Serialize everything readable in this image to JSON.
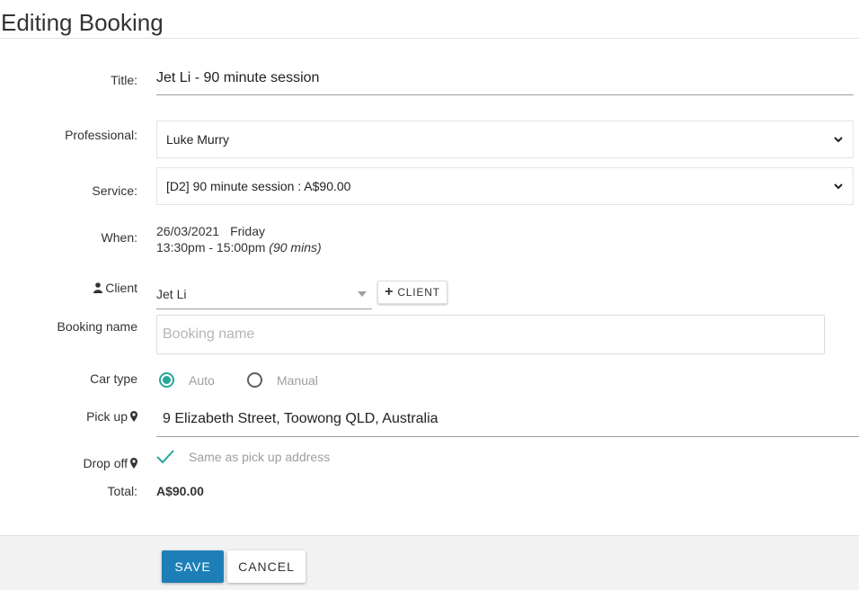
{
  "page": {
    "title": "Editing Booking"
  },
  "form": {
    "title": {
      "label": "Title:",
      "value": "Jet Li - 90 minute session"
    },
    "professional": {
      "label": "Professional:",
      "value": "Luke Murry"
    },
    "service": {
      "label": "Service:",
      "value": "[D2] 90 minute session : A$90.00"
    },
    "when": {
      "label": "When:",
      "date": "26/03/2021",
      "day": "Friday",
      "time": "13:30pm - 15:00pm",
      "duration": "(90 mins)"
    },
    "client": {
      "label": "Client",
      "value": "Jet Li",
      "add_button": "CLIENT"
    },
    "booking_name": {
      "label": "Booking name",
      "value": "",
      "placeholder": "Booking name"
    },
    "car_type": {
      "label": "Car type",
      "options": [
        "Auto",
        "Manual"
      ],
      "selected": "Auto"
    },
    "pick_up": {
      "label": "Pick up",
      "value": "9 Elizabeth Street, Toowong QLD, Australia"
    },
    "drop_off": {
      "label": "Drop off",
      "same_as_pickup_label": "Same as pick up address",
      "same_as_pickup_checked": true
    },
    "total": {
      "label": "Total:",
      "value": "A$90.00"
    }
  },
  "actions": {
    "save": "SAVE",
    "cancel": "CANCEL"
  },
  "colors": {
    "primary": "#1e7fb8",
    "accent": "#26a69a"
  }
}
